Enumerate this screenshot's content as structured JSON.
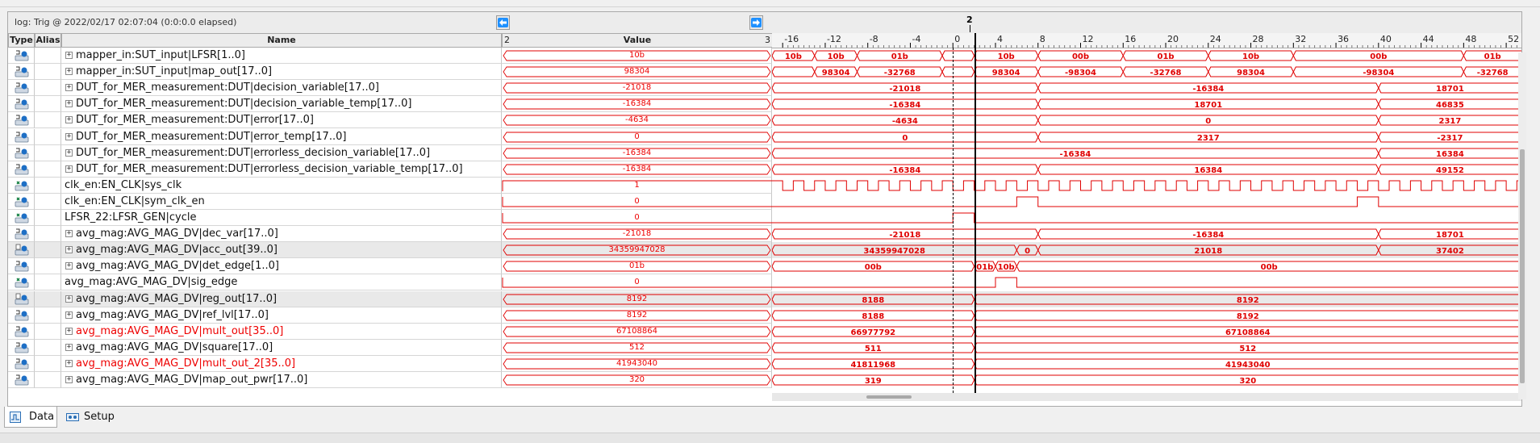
{
  "log": {
    "text": "log: Trig @ 2022/02/17 02:07:04 (0:0:0.0 elapsed)"
  },
  "cursor": {
    "label": "2"
  },
  "headers": {
    "type": "Type",
    "alias": "Alias",
    "name": "Name",
    "value_left": "2",
    "value": "Value",
    "value_right": "3"
  },
  "ruler": {
    "ticks": [
      "-16",
      "-12",
      "-8",
      "-4",
      "0",
      "4",
      "8",
      "12",
      "16",
      "20",
      "24",
      "28",
      "32",
      "36",
      "40",
      "44",
      "48",
      "52"
    ]
  },
  "signals": [
    {
      "name": "mapper_in:SUT_input|LFSR[1..0]",
      "value": "10b",
      "expand": true,
      "icon": "bus-icon",
      "color": "black",
      "kind": "bus",
      "segments": [
        {
          "t0": -17,
          "t1": -13,
          "label": "10b"
        },
        {
          "t0": -13,
          "t1": -9,
          "label": "10b"
        },
        {
          "t0": -9,
          "t1": -1,
          "label": "01b"
        },
        {
          "t0": -1,
          "t1": 2,
          "label": ""
        },
        {
          "t0": 2,
          "t1": 8,
          "label": "10b"
        },
        {
          "t0": 8,
          "t1": 16,
          "label": "00b"
        },
        {
          "t0": 16,
          "t1": 24,
          "label": "01b"
        },
        {
          "t0": 24,
          "t1": 32,
          "label": "10b"
        },
        {
          "t0": 32,
          "t1": 48,
          "label": "00b"
        },
        {
          "t0": 48,
          "t1": 56,
          "label": "01b"
        }
      ]
    },
    {
      "name": "mapper_in:SUT_input|map_out[17..0]",
      "value": "98304",
      "expand": true,
      "icon": "bus-icon",
      "color": "black",
      "kind": "bus",
      "segments": [
        {
          "t0": -17,
          "t1": -13,
          "label": ""
        },
        {
          "t0": -13,
          "t1": -9,
          "label": "98304"
        },
        {
          "t0": -9,
          "t1": -1,
          "label": "-32768"
        },
        {
          "t0": -1,
          "t1": 2,
          "label": ""
        },
        {
          "t0": 2,
          "t1": 8,
          "label": "98304"
        },
        {
          "t0": 8,
          "t1": 16,
          "label": "-98304"
        },
        {
          "t0": 16,
          "t1": 24,
          "label": "-32768"
        },
        {
          "t0": 24,
          "t1": 32,
          "label": "98304"
        },
        {
          "t0": 32,
          "t1": 48,
          "label": "-98304"
        },
        {
          "t0": 48,
          "t1": 56,
          "label": "-32768"
        }
      ]
    },
    {
      "name": "DUT_for_MER_measurement:DUT|decision_variable[17..0]",
      "value": "-21018",
      "expand": true,
      "icon": "bus-icon",
      "color": "black",
      "kind": "bus",
      "segments": [
        {
          "t0": -17,
          "t1": 8,
          "label": "-21018"
        },
        {
          "t0": 8,
          "t1": 40,
          "label": "-16384"
        },
        {
          "t0": 40,
          "t1": 56,
          "label": "18701"
        }
      ]
    },
    {
      "name": "DUT_for_MER_measurement:DUT|decision_variable_temp[17..0]",
      "value": "-16384",
      "expand": true,
      "icon": "bus-icon",
      "color": "black",
      "kind": "bus",
      "segments": [
        {
          "t0": -17,
          "t1": 8,
          "label": "-16384"
        },
        {
          "t0": 8,
          "t1": 40,
          "label": "18701"
        },
        {
          "t0": 40,
          "t1": 56,
          "label": "46835"
        }
      ]
    },
    {
      "name": "DUT_for_MER_measurement:DUT|error[17..0]",
      "value": "-4634",
      "expand": true,
      "icon": "bus-icon",
      "color": "black",
      "kind": "bus",
      "segments": [
        {
          "t0": -17,
          "t1": 8,
          "label": "-4634"
        },
        {
          "t0": 8,
          "t1": 40,
          "label": "0"
        },
        {
          "t0": 40,
          "t1": 56,
          "label": "2317"
        }
      ]
    },
    {
      "name": "DUT_for_MER_measurement:DUT|error_temp[17..0]",
      "value": "0",
      "expand": true,
      "icon": "bus-icon",
      "color": "black",
      "kind": "bus",
      "segments": [
        {
          "t0": -17,
          "t1": 8,
          "label": "0"
        },
        {
          "t0": 8,
          "t1": 40,
          "label": "2317"
        },
        {
          "t0": 40,
          "t1": 56,
          "label": "-2317"
        }
      ]
    },
    {
      "name": "DUT_for_MER_measurement:DUT|errorless_decision_variable[17..0]",
      "value": "-16384",
      "expand": true,
      "icon": "bus-icon",
      "color": "black",
      "kind": "bus",
      "segments": [
        {
          "t0": -17,
          "t1": 40,
          "label": "-16384"
        },
        {
          "t0": 40,
          "t1": 56,
          "label": "16384"
        }
      ]
    },
    {
      "name": "DUT_for_MER_measurement:DUT|errorless_decision_variable_temp[17..0]",
      "value": "-16384",
      "expand": true,
      "icon": "bus-icon",
      "color": "black",
      "kind": "bus",
      "segments": [
        {
          "t0": -17,
          "t1": 8,
          "label": "-16384"
        },
        {
          "t0": 8,
          "t1": 40,
          "label": "16384"
        },
        {
          "t0": 40,
          "t1": 56,
          "label": "49152"
        }
      ]
    },
    {
      "name": "clk_en:EN_CLK|sys_clk",
      "value": "1",
      "expand": false,
      "icon": "bit-icon",
      "color": "black",
      "kind": "clock"
    },
    {
      "name": "clk_en:EN_CLK|sym_clk_en",
      "value": "0",
      "expand": false,
      "icon": "bit-icon",
      "color": "black",
      "kind": "bit",
      "pulses": [
        [
          6,
          8
        ],
        [
          38,
          40
        ]
      ]
    },
    {
      "name": "LFSR_22:LFSR_GEN|cycle",
      "value": "0",
      "expand": false,
      "icon": "bit-icon",
      "color": "black",
      "kind": "bit",
      "pulses": [
        [
          0,
          2
        ]
      ]
    },
    {
      "name": "avg_mag:AVG_MAG_DV|dec_var[17..0]",
      "value": "-21018",
      "expand": true,
      "icon": "bus-icon",
      "color": "black",
      "kind": "bus",
      "segments": [
        {
          "t0": -17,
          "t1": 8,
          "label": "-21018"
        },
        {
          "t0": 8,
          "t1": 40,
          "label": "-16384"
        },
        {
          "t0": 40,
          "t1": 56,
          "label": "18701"
        }
      ]
    },
    {
      "name": "avg_mag:AVG_MAG_DV|acc_out[39..0]",
      "value": "34359947028",
      "expand": true,
      "icon": "reg-icon",
      "color": "black",
      "kind": "bus",
      "highlight": true,
      "segments": [
        {
          "t0": -17,
          "t1": 6,
          "label": "34359947028"
        },
        {
          "t0": 6,
          "t1": 8,
          "label": "0"
        },
        {
          "t0": 8,
          "t1": 40,
          "label": "21018"
        },
        {
          "t0": 40,
          "t1": 56,
          "label": "37402"
        }
      ]
    },
    {
      "name": "avg_mag:AVG_MAG_DV|det_edge[1..0]",
      "value": "01b",
      "expand": true,
      "icon": "bus-icon",
      "color": "black",
      "kind": "bus",
      "segments": [
        {
          "t0": -17,
          "t1": 2,
          "label": "00b"
        },
        {
          "t0": 2,
          "t1": 4,
          "label": "01b"
        },
        {
          "t0": 4,
          "t1": 6,
          "label": "10b"
        },
        {
          "t0": 6,
          "t1": 56,
          "label": "00b"
        }
      ]
    },
    {
      "name": "avg_mag:AVG_MAG_DV|sig_edge",
      "value": "0",
      "expand": false,
      "icon": "bit-icon",
      "color": "black",
      "kind": "bit",
      "pulses": [
        [
          4,
          6
        ]
      ]
    },
    {
      "name": "avg_mag:AVG_MAG_DV|reg_out[17..0]",
      "value": "8192",
      "expand": true,
      "icon": "reg-icon",
      "color": "black",
      "kind": "bus",
      "highlight": true,
      "segments": [
        {
          "t0": -17,
          "t1": 2,
          "label": "8188"
        },
        {
          "t0": 2,
          "t1": 56,
          "label": "8192"
        }
      ]
    },
    {
      "name": "avg_mag:AVG_MAG_DV|ref_lvl[17..0]",
      "value": "8192",
      "expand": true,
      "icon": "bus-icon",
      "color": "black",
      "kind": "bus",
      "segments": [
        {
          "t0": -17,
          "t1": 2,
          "label": "8188"
        },
        {
          "t0": 2,
          "t1": 56,
          "label": "8192"
        }
      ]
    },
    {
      "name": "avg_mag:AVG_MAG_DV|mult_out[35..0]",
      "value": "67108864",
      "expand": true,
      "icon": "bus-icon",
      "color": "red",
      "kind": "bus",
      "segments": [
        {
          "t0": -17,
          "t1": 2,
          "label": "66977792"
        },
        {
          "t0": 2,
          "t1": 56,
          "label": "67108864"
        }
      ]
    },
    {
      "name": "avg_mag:AVG_MAG_DV|square[17..0]",
      "value": "512",
      "expand": true,
      "icon": "bus-icon",
      "color": "black",
      "kind": "bus",
      "segments": [
        {
          "t0": -17,
          "t1": 2,
          "label": "511"
        },
        {
          "t0": 2,
          "t1": 56,
          "label": "512"
        }
      ]
    },
    {
      "name": "avg_mag:AVG_MAG_DV|mult_out_2[35..0]",
      "value": "41943040",
      "expand": true,
      "icon": "bus-icon",
      "color": "red",
      "kind": "bus",
      "segments": [
        {
          "t0": -17,
          "t1": 2,
          "label": "41811968"
        },
        {
          "t0": 2,
          "t1": 56,
          "label": "41943040"
        }
      ]
    },
    {
      "name": "avg_mag:AVG_MAG_DV|map_out_pwr[17..0]",
      "value": "320",
      "expand": true,
      "icon": "bus-icon",
      "color": "black",
      "kind": "bus",
      "segments": [
        {
          "t0": -17,
          "t1": 2,
          "label": "319"
        },
        {
          "t0": 2,
          "t1": 56,
          "label": "320"
        }
      ]
    }
  ],
  "tabs": [
    {
      "label": "Data",
      "icon": "waveform-icon",
      "active": true
    },
    {
      "label": "Setup",
      "icon": "settings-icon",
      "active": false
    }
  ],
  "colors": {
    "wave": "#e00000",
    "accent": "#1e90ff",
    "highlight_row": "#e9e9e9"
  }
}
